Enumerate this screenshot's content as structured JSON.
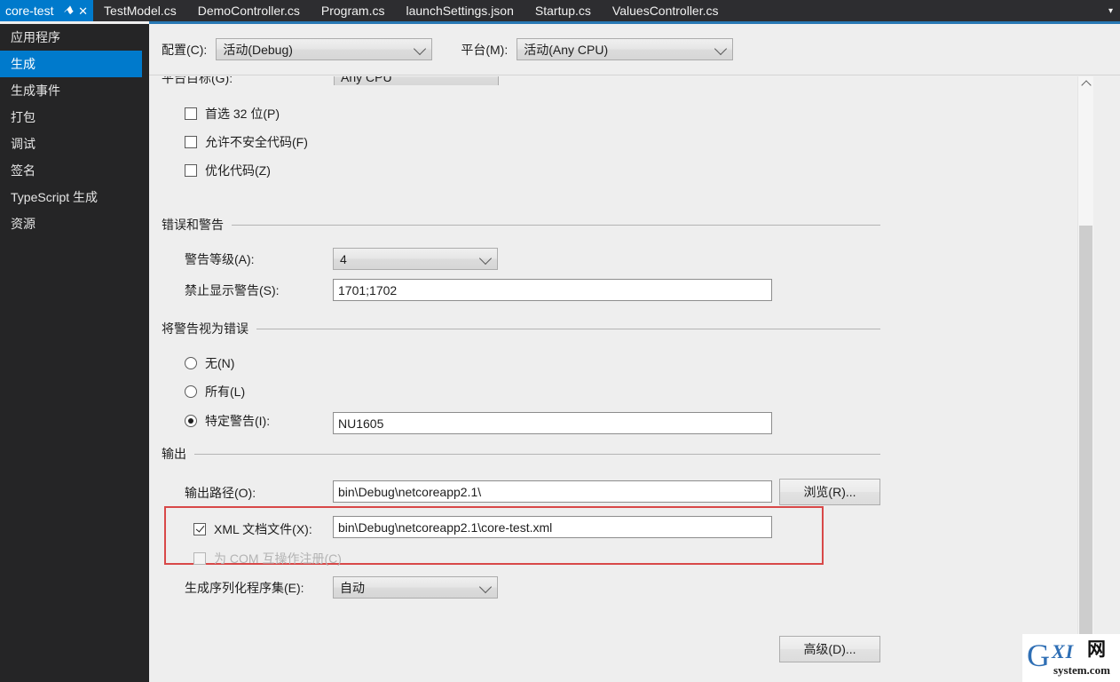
{
  "tabs": {
    "items": [
      {
        "label": "core-test",
        "active": true,
        "pin_icon": "⚑",
        "close_icon": "✕"
      },
      {
        "label": "TestModel.cs",
        "active": false
      },
      {
        "label": "DemoController.cs",
        "active": false
      },
      {
        "label": "Program.cs",
        "active": false
      },
      {
        "label": "launchSettings.json",
        "active": false
      },
      {
        "label": "Startup.cs",
        "active": false
      },
      {
        "label": "ValuesController.cs",
        "active": false
      }
    ],
    "overflow_icon": "▾"
  },
  "sidebar": {
    "items": [
      {
        "label": "应用程序",
        "selected": false
      },
      {
        "label": "生成",
        "selected": true
      },
      {
        "label": "生成事件",
        "selected": false
      },
      {
        "label": "打包",
        "selected": false
      },
      {
        "label": "调试",
        "selected": false
      },
      {
        "label": "签名",
        "selected": false
      },
      {
        "label": "TypeScript 生成",
        "selected": false
      },
      {
        "label": "资源",
        "selected": false
      }
    ]
  },
  "config_bar": {
    "configuration_label": "配置(C):",
    "configuration_value": "活动(Debug)",
    "platform_label": "平台(M):",
    "platform_value": "活动(Any CPU)"
  },
  "general": {
    "platform_target_label": "平台目标(G):",
    "platform_target_value": "Any CPU",
    "prefer32_label": "首选 32 位(P)",
    "prefer32_checked": false,
    "unsafe_label": "允许不安全代码(F)",
    "unsafe_checked": false,
    "optimize_label": "优化代码(Z)",
    "optimize_checked": false
  },
  "errors_warnings": {
    "section_title": "错误和警告",
    "warning_level_label": "警告等级(A):",
    "warning_level_value": "4",
    "suppress_label": "禁止显示警告(S):",
    "suppress_value": "1701;1702"
  },
  "warnings_as_errors": {
    "section_title": "将警告视为错误",
    "none_label": "无(N)",
    "none_selected": false,
    "all_label": "所有(L)",
    "all_selected": false,
    "specific_label": "特定警告(I):",
    "specific_selected": true,
    "specific_value": "NU1605"
  },
  "output": {
    "section_title": "输出",
    "output_path_label": "输出路径(O):",
    "output_path_value": "bin\\Debug\\netcoreapp2.1\\",
    "browse_label": "浏览(R)...",
    "xml_doc_label": "XML 文档文件(X):",
    "xml_doc_checked": true,
    "xml_doc_value": "bin\\Debug\\netcoreapp2.1\\core-test.xml",
    "com_label": "为 COM 互操作注册(C)",
    "com_checked": false,
    "com_disabled": true,
    "serialization_label": "生成序列化程序集(E):",
    "serialization_value": "自动",
    "advanced_label": "高级(D)..."
  },
  "watermark": {
    "letter": "G",
    "xi": "XI",
    "net": "网",
    "domain": "system.com"
  },
  "colors": {
    "accent": "#007acc",
    "tabbar_bg": "#2d2d30",
    "sidebar_bg": "#252526",
    "panel_bg": "#eeeeee",
    "highlight_red": "#d84848"
  }
}
